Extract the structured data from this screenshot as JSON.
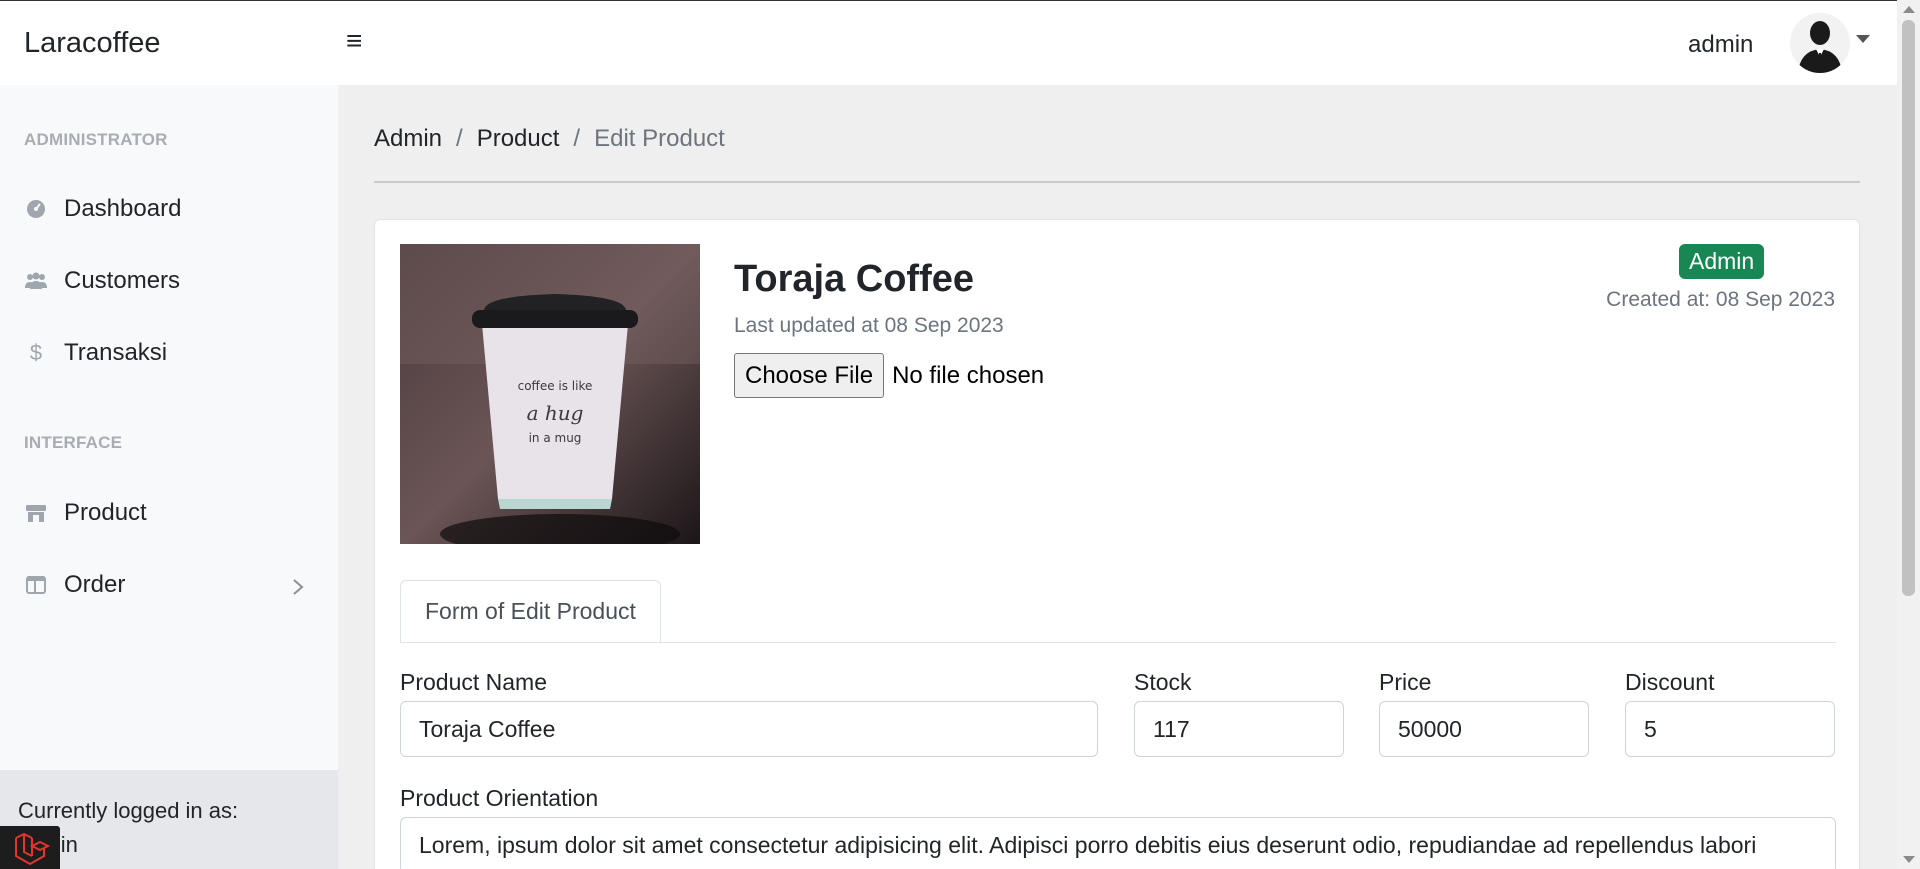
{
  "app": {
    "brand": "Laracoffee"
  },
  "header": {
    "menu_icon": "hamburger-icon",
    "user_name": "admin",
    "avatar_icon": "user-avatar-icon"
  },
  "sidebar": {
    "sections": [
      {
        "heading": "ADMINISTRATOR",
        "items": [
          {
            "label": "Dashboard",
            "icon": "speedometer-icon"
          },
          {
            "label": "Customers",
            "icon": "users-icon"
          },
          {
            "label": "Transaksi",
            "icon": "dollar-icon"
          }
        ]
      },
      {
        "heading": "INTERFACE",
        "items": [
          {
            "label": "Product",
            "icon": "store-icon"
          },
          {
            "label": "Order",
            "icon": "columns-icon"
          }
        ]
      }
    ],
    "footer": {
      "label": "Currently logged in as:",
      "user": "admin"
    }
  },
  "breadcrumb": {
    "items": [
      "Admin",
      "Product"
    ],
    "active": "Edit Product"
  },
  "product": {
    "title": "Toraja Coffee",
    "updated": "Last updated at 08 Sep 2023",
    "file_button": "Choose File",
    "file_status": "No file chosen",
    "role_badge": "Admin",
    "created": "Created at: 08 Sep 2023",
    "image_text": [
      "coffee is like",
      "a hug",
      "in a mug"
    ]
  },
  "form": {
    "tab_label": "Form of Edit Product",
    "fields": {
      "name": {
        "label": "Product Name",
        "value": "Toraja Coffee"
      },
      "stock": {
        "label": "Stock",
        "value": "117"
      },
      "price": {
        "label": "Price",
        "value": "50000"
      },
      "discount": {
        "label": "Discount",
        "value": "5"
      },
      "orientation": {
        "label": "Product Orientation",
        "value": "Lorem, ipsum dolor sit amet consectetur adipisicing elit. Adipisci porro debitis eius deserunt odio, repudiandae ad repellendus labori"
      }
    }
  },
  "colors": {
    "accent_badge": "#198754",
    "sidebar_bg": "#f8f9fa",
    "main_bg": "#efefef"
  }
}
